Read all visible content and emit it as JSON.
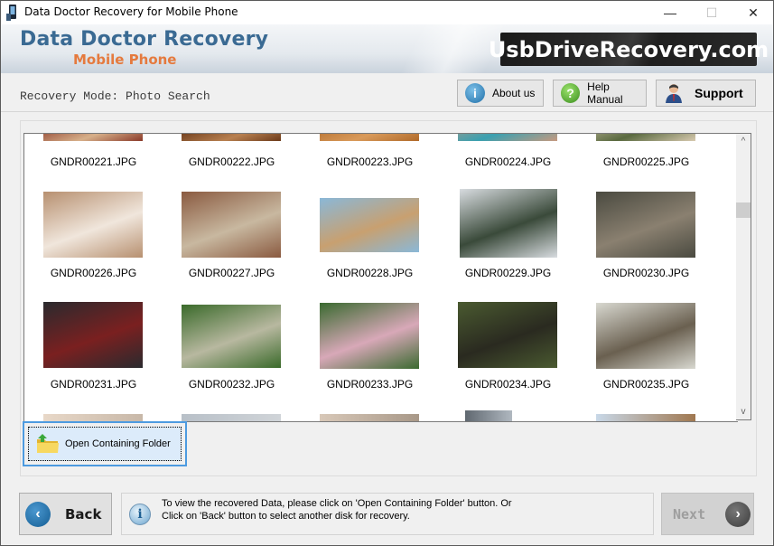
{
  "window": {
    "title": "Data Doctor Recovery for Mobile Phone",
    "controls": {
      "minimize": "—",
      "maximize": "☐",
      "close": "✕"
    }
  },
  "banner": {
    "title": "Data Doctor Recovery",
    "subtitle": "Mobile Phone",
    "brand": "UsbDriveRecovery.com"
  },
  "mode": {
    "label": "Recovery Mode: Photo Search"
  },
  "toolbar": {
    "about": {
      "label": "About us",
      "icon": "info-icon",
      "glyph": "i"
    },
    "help": {
      "label": "Help Manual",
      "icon": "question-icon",
      "glyph": "?"
    },
    "support": {
      "label": "Support",
      "icon": "support-person-icon"
    }
  },
  "files": [
    {
      "name": "GNDR00221.JPG",
      "colors": [
        "#8a3a2a",
        "#d7b08a"
      ]
    },
    {
      "name": "GNDR00222.JPG",
      "colors": [
        "#6b3a1a",
        "#b88050"
      ]
    },
    {
      "name": "GNDR00223.JPG",
      "colors": [
        "#b06a2a",
        "#d99a5a"
      ]
    },
    {
      "name": "GNDR00224.JPG",
      "colors": [
        "#c79a80",
        "#3aa0b0"
      ]
    },
    {
      "name": "GNDR00225.JPG",
      "colors": [
        "#d8cab0",
        "#5a6a40"
      ]
    },
    {
      "name": "GNDR00226.JPG",
      "colors": [
        "#b79070",
        "#f0e6dc"
      ]
    },
    {
      "name": "GNDR00227.JPG",
      "colors": [
        "#8a5a40",
        "#c8b8a0"
      ]
    },
    {
      "name": "GNDR00228.JPG",
      "colors": [
        "#8ab8d8",
        "#c8a070"
      ]
    },
    {
      "name": "GNDR00229.JPG",
      "colors": [
        "#d8dce0",
        "#3a4a3a"
      ]
    },
    {
      "name": "GNDR00230.JPG",
      "colors": [
        "#4a4a40",
        "#8a8070"
      ]
    },
    {
      "name": "GNDR00231.JPG",
      "colors": [
        "#2a2a2e",
        "#7a2020"
      ]
    },
    {
      "name": "GNDR00232.JPG",
      "colors": [
        "#3a6a2a",
        "#b8b8a0"
      ]
    },
    {
      "name": "GNDR00233.JPG",
      "colors": [
        "#3a6a30",
        "#d8a8b8"
      ]
    },
    {
      "name": "GNDR00234.JPG",
      "colors": [
        "#4a5a30",
        "#2a2a20"
      ]
    },
    {
      "name": "GNDR00235.JPG",
      "colors": [
        "#d8d8d0",
        "#6a6050"
      ]
    }
  ],
  "scrollbar": {
    "up": "^",
    "down": "v",
    "position": 0.27
  },
  "open_folder": {
    "label": "Open Containing Folder",
    "icon": "folder-open-icon"
  },
  "nav": {
    "back": {
      "label": "Back",
      "glyph": "‹"
    },
    "next": {
      "label": "Next",
      "glyph": "›",
      "enabled": false
    }
  },
  "info": {
    "line1": "To view the recovered Data, please click on 'Open Containing Folder' button. Or",
    "line2": "Click on 'Back' button to select another disk for recovery.",
    "glyph": "i"
  }
}
